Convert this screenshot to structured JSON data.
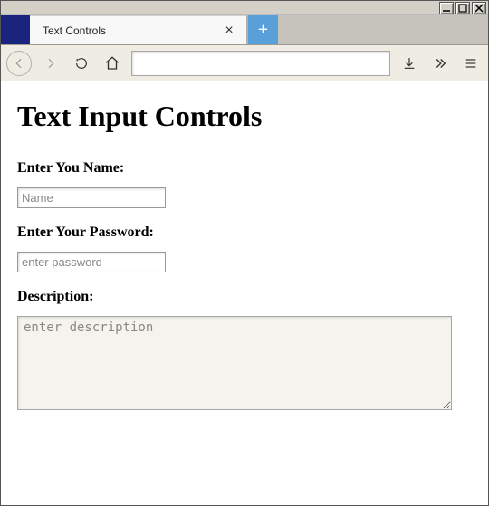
{
  "window": {
    "tab_title": "Text Controls"
  },
  "page": {
    "heading": "Text Input Controls",
    "name_label": "Enter You Name:",
    "name_placeholder": "Name",
    "name_value": "",
    "password_label": "Enter Your Password:",
    "password_placeholder": "enter password",
    "password_value": "",
    "description_label": "Description:",
    "description_placeholder": "enter description",
    "description_value": ""
  }
}
